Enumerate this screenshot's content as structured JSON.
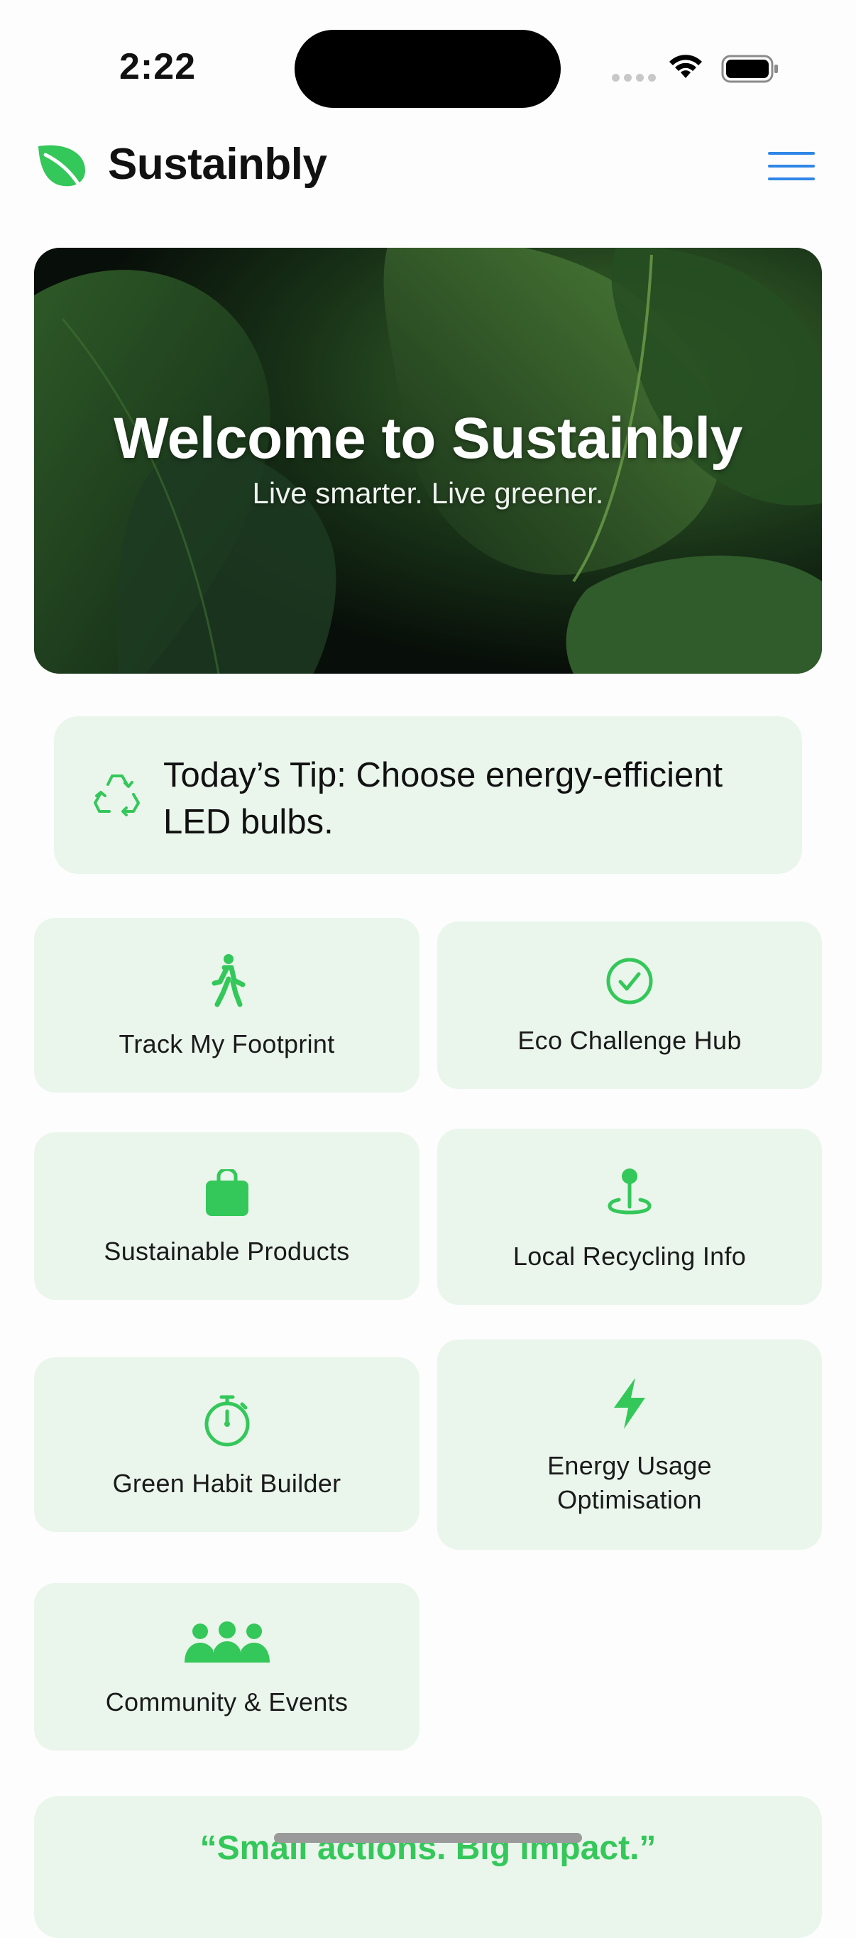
{
  "status_bar": {
    "time": "2:22"
  },
  "header": {
    "app_title": "Sustainbly",
    "menu_icon": "hamburger-icon",
    "logo_icon": "leaf-icon"
  },
  "hero": {
    "title": "Welcome to Sustainbly",
    "subtitle": "Live smarter. Live greener."
  },
  "tip": {
    "icon": "recycle-icon",
    "text": "Today’s Tip: Choose energy-efficient LED bulbs."
  },
  "features": [
    {
      "label": "Track My Footprint",
      "icon": "walking-person-icon"
    },
    {
      "label": "Eco Challenge Hub",
      "icon": "checkmark-circle-icon"
    },
    {
      "label": "Sustainable Products",
      "icon": "shopping-bag-icon"
    },
    {
      "label": "Local Recycling Info",
      "icon": "map-pin-icon"
    },
    {
      "label": "Green Habit Builder",
      "icon": "timer-icon"
    },
    {
      "label": "Energy Usage Optimisation",
      "icon": "bolt-icon"
    },
    {
      "label": "Community & Events",
      "icon": "people-group-icon"
    }
  ],
  "quote": {
    "text": "“Small actions. Big impact.”"
  },
  "colors": {
    "accent_green": "#34c759",
    "card_bg": "#eaf6ec",
    "menu_blue": "#2f86e6"
  }
}
